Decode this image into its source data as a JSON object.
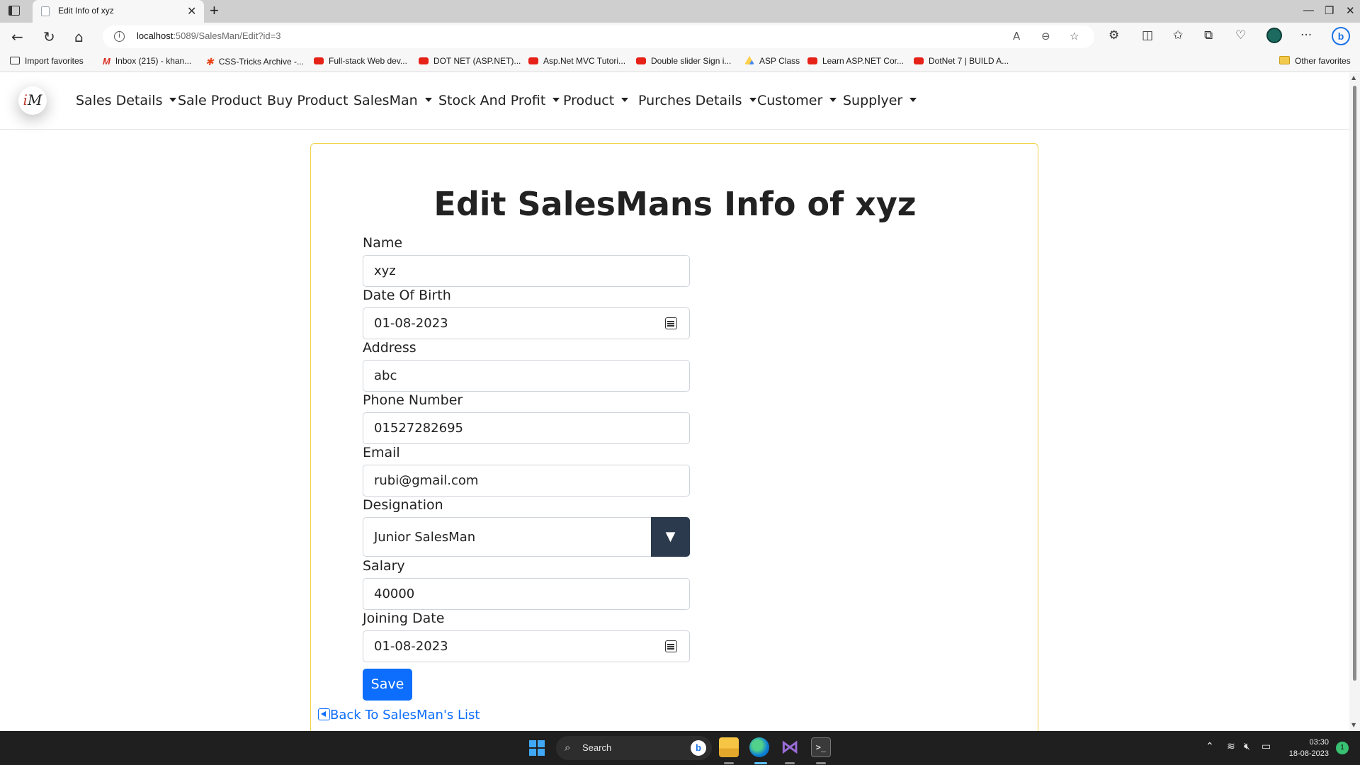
{
  "browser": {
    "tab_title": "Edit Info of xyz",
    "url_host": "localhost",
    "url_path": ":5089/SalesMan/Edit?id=3",
    "favorites": [
      {
        "label": "Import favorites",
        "icon": "import-icon"
      },
      {
        "label": "Inbox (215) - khan...",
        "icon": "gmail-icon"
      },
      {
        "label": "CSS-Tricks Archive -...",
        "icon": "csstricks-icon"
      },
      {
        "label": "Full-stack Web dev...",
        "icon": "youtube-icon"
      },
      {
        "label": "DOT NET (ASP.NET)...",
        "icon": "youtube-icon"
      },
      {
        "label": "Asp.Net MVC Tutori...",
        "icon": "youtube-icon"
      },
      {
        "label": "Double slider Sign i...",
        "icon": "youtube-icon"
      },
      {
        "label": "ASP Class",
        "icon": "google-drive-icon"
      },
      {
        "label": "Learn ASP.NET Cor...",
        "icon": "youtube-icon"
      },
      {
        "label": "DotNet 7 | BUILD A...",
        "icon": "youtube-icon"
      }
    ],
    "other_favorites": "Other favorites"
  },
  "navbar": {
    "logo_text": "M",
    "items": [
      {
        "label": "Sales Details",
        "dropdown": true
      },
      {
        "label": "Sale Product",
        "dropdown": false
      },
      {
        "label": "Buy Product",
        "dropdown": false
      },
      {
        "label": "SalesMan",
        "dropdown": true
      },
      {
        "label": "Stock And Profit",
        "dropdown": true
      },
      {
        "label": "Product",
        "dropdown": true
      },
      {
        "label": "Purches Details",
        "dropdown": true
      },
      {
        "label": "Customer",
        "dropdown": true
      },
      {
        "label": "Supplyer",
        "dropdown": true
      }
    ]
  },
  "form": {
    "title": "Edit SalesMans Info of xyz",
    "fields": [
      {
        "label": "Name",
        "value": "xyz"
      },
      {
        "label": "Date Of Birth",
        "value": "01-08-2023"
      },
      {
        "label": "Address",
        "value": "abc"
      },
      {
        "label": "Phone Number",
        "value": "01527282695"
      },
      {
        "label": "Email",
        "value": "rubi@gmail.com"
      },
      {
        "label": "Designation",
        "value": "Junior SalesMan"
      },
      {
        "label": "Salary",
        "value": "40000"
      },
      {
        "label": "Joining Date",
        "value": "01-08-2023"
      }
    ],
    "save_label": "Save",
    "back_label": "Back To SalesMan's List"
  },
  "taskbar": {
    "search_label": "Search",
    "time": "03:30",
    "date": "18-08-2023",
    "notification_count": "1"
  },
  "colors": {
    "primary": "#0d6efd",
    "card_border": "#f2d24b",
    "select_arrow_bg": "#2b3a4d"
  }
}
